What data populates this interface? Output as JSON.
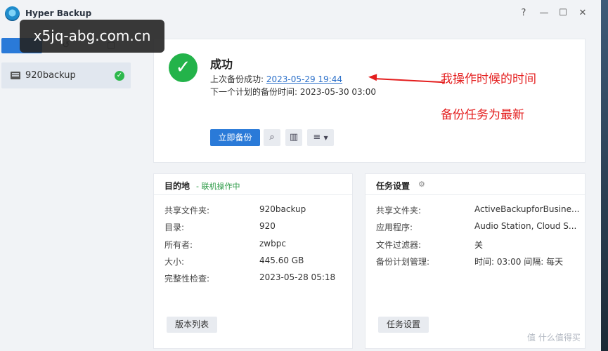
{
  "window": {
    "title": "Hyper Backup",
    "help_label": "?",
    "min_label": "—",
    "max_label": "☐",
    "close_label": "✕"
  },
  "watermark": "x5jq-abg.com.cn",
  "sidebar": {
    "tasks": [
      {
        "label": "920backup",
        "status": "success"
      }
    ]
  },
  "status": {
    "title": "成功",
    "last_backup_label": "上次备份成功: ",
    "last_backup_time": "2023-05-29 19:44",
    "next_backup_label": "下一个计划的备份时间: ",
    "next_backup_time": "2023-05-30 03:00",
    "backup_now_label": "立即备份",
    "annotation_1": "我操作时候的时间",
    "annotation_2": "备份任务为最新"
  },
  "destination": {
    "title": "目的地",
    "subtitle": "- 联机操作中",
    "rows": [
      {
        "label": "共享文件夹:",
        "value": "920backup"
      },
      {
        "label": "目录:",
        "value": "920"
      },
      {
        "label": "所有者:",
        "value": "zwbpc"
      },
      {
        "label": "大小:",
        "value": "445.60 GB"
      },
      {
        "label": "完整性检查:",
        "value": "2023-05-28 05:18"
      }
    ],
    "button_label": "版本列表"
  },
  "task_settings": {
    "title": "任务设置",
    "rows": [
      {
        "label": "共享文件夹:",
        "value": "ActiveBackupforBusine..."
      },
      {
        "label": "应用程序:",
        "value": "Audio Station, Cloud S..."
      },
      {
        "label": "文件过滤器:",
        "value": "关"
      },
      {
        "label": "备份计划管理:",
        "value": "时间: 03:00 间隔: 每天"
      }
    ],
    "button_label": "任务设置"
  },
  "corner_mark": "值 什么值得买",
  "colors": {
    "accent": "#2a7ad8",
    "success": "#23b34a",
    "annotation": "#e41e1e",
    "online": "#2b9a45"
  }
}
